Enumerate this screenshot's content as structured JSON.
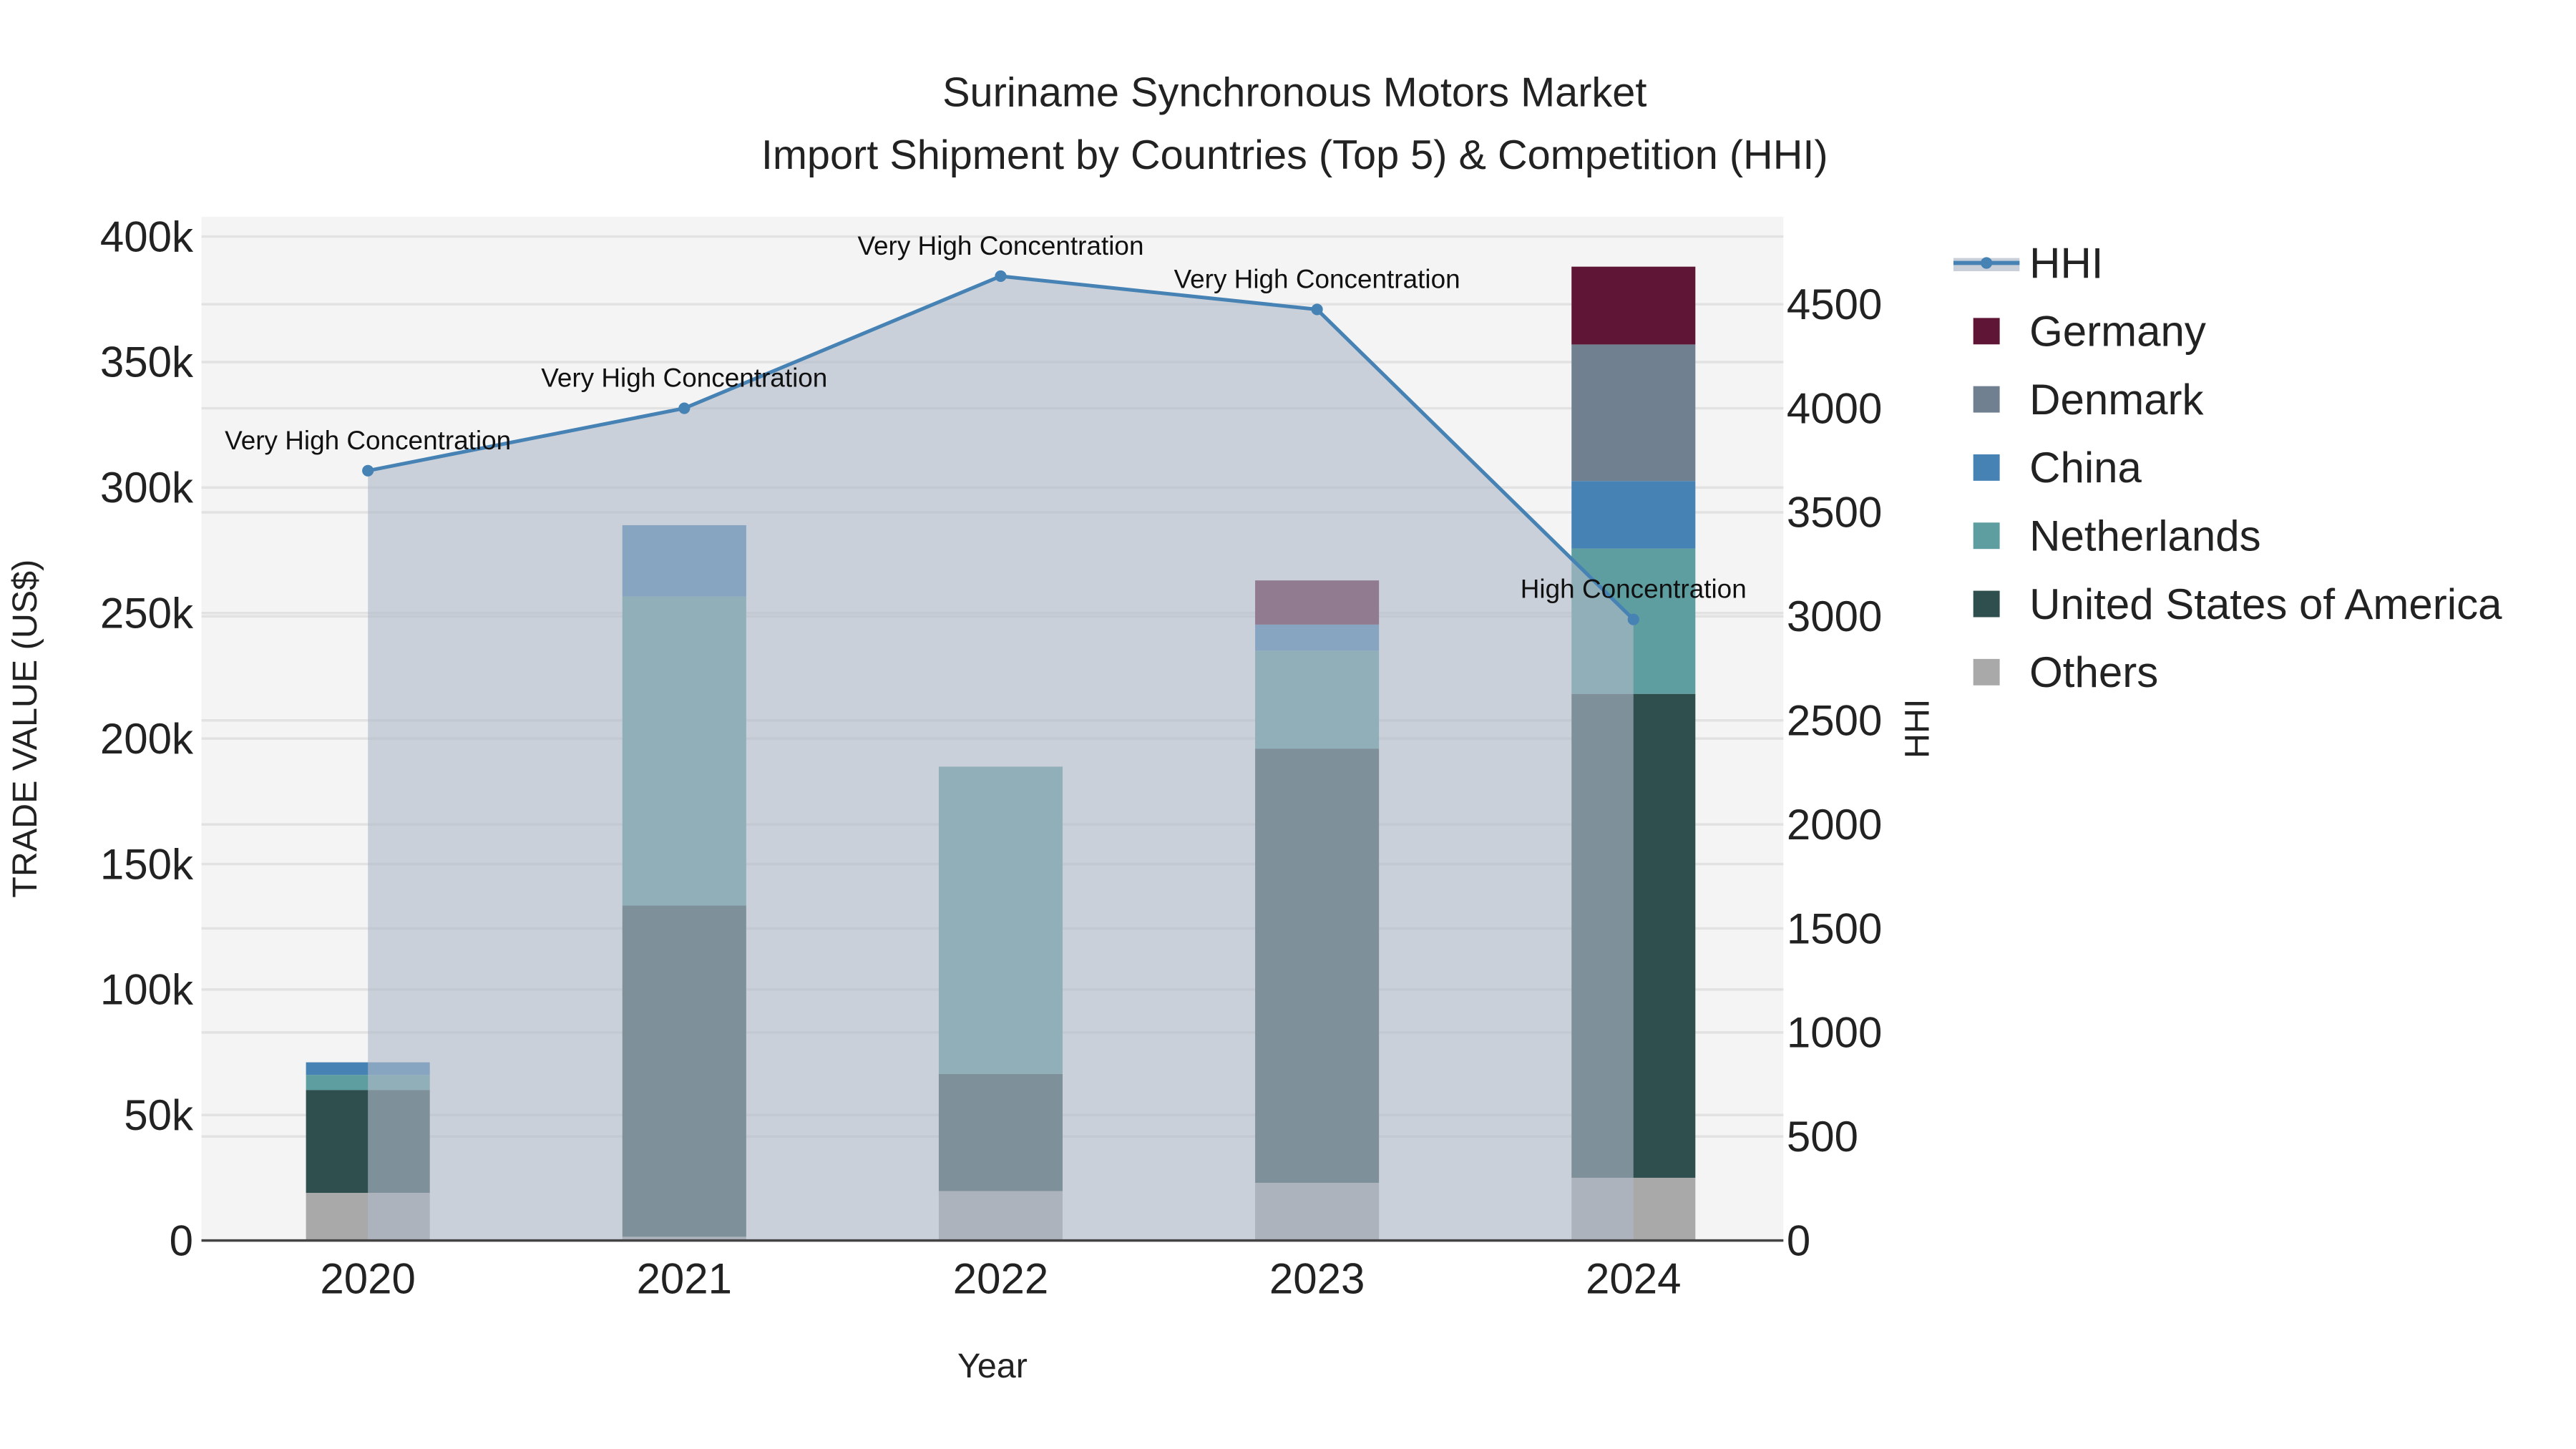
{
  "chart_data": {
    "type": "bar",
    "title": "Suriname Synchronous Motors Market",
    "subtitle": "Import Shipment by Countries (Top 5) & Competition (HHI)",
    "xlabel": "Year",
    "ylabel": "TRADE VALUE (US$)",
    "y2label": "HHI",
    "categories": [
      "2020",
      "2021",
      "2022",
      "2023",
      "2024"
    ],
    "ylim": [
      0,
      400000
    ],
    "y_ticks": [
      0,
      50000,
      100000,
      150000,
      200000,
      250000,
      300000,
      350000,
      400000
    ],
    "y_tick_labels": [
      "0",
      "50k",
      "100k",
      "150k",
      "200k",
      "250k",
      "300k",
      "350k",
      "400k"
    ],
    "y2lim": [
      0,
      4500
    ],
    "y2_ticks": [
      0,
      500,
      1000,
      1500,
      2000,
      2500,
      3000,
      3500,
      4000,
      4500
    ],
    "y2_tick_labels": [
      "0",
      "500",
      "1000",
      "1500",
      "2000",
      "2500",
      "3000",
      "3500",
      "4000",
      "4500"
    ],
    "stacked": true,
    "series": [
      {
        "name": "Others",
        "color": "#a9a9a9",
        "values": [
          19000,
          1500,
          19700,
          23000,
          25000
        ]
      },
      {
        "name": "United States of America",
        "color": "#2f4f4f",
        "values": [
          41000,
          132000,
          46700,
          173000,
          192800
        ]
      },
      {
        "name": "Netherlands",
        "color": "#5f9ea0",
        "values": [
          6000,
          123100,
          122400,
          39000,
          57900
        ]
      },
      {
        "name": "China",
        "color": "#4682b4",
        "values": [
          5000,
          28400,
          0,
          10400,
          26900
        ]
      },
      {
        "name": "Denmark",
        "color": "#708090",
        "values": [
          0,
          0,
          0,
          0,
          54400
        ]
      },
      {
        "name": "Germany",
        "color": "#5f1535",
        "values": [
          0,
          0,
          0,
          17600,
          31000
        ]
      }
    ],
    "line": {
      "name": "HHI",
      "color": "#4682b4",
      "values": [
        3700,
        4000,
        4635,
        4475,
        2985
      ],
      "annotations": [
        "Very High Concentration",
        "Very High Concentration",
        "Very High Concentration",
        "Very High Concentration",
        "High Concentration"
      ]
    },
    "legend": {
      "placement": "right",
      "entries": [
        "HHI",
        "Germany",
        "Denmark",
        "China",
        "Netherlands",
        "United States of America",
        "Others"
      ]
    }
  }
}
